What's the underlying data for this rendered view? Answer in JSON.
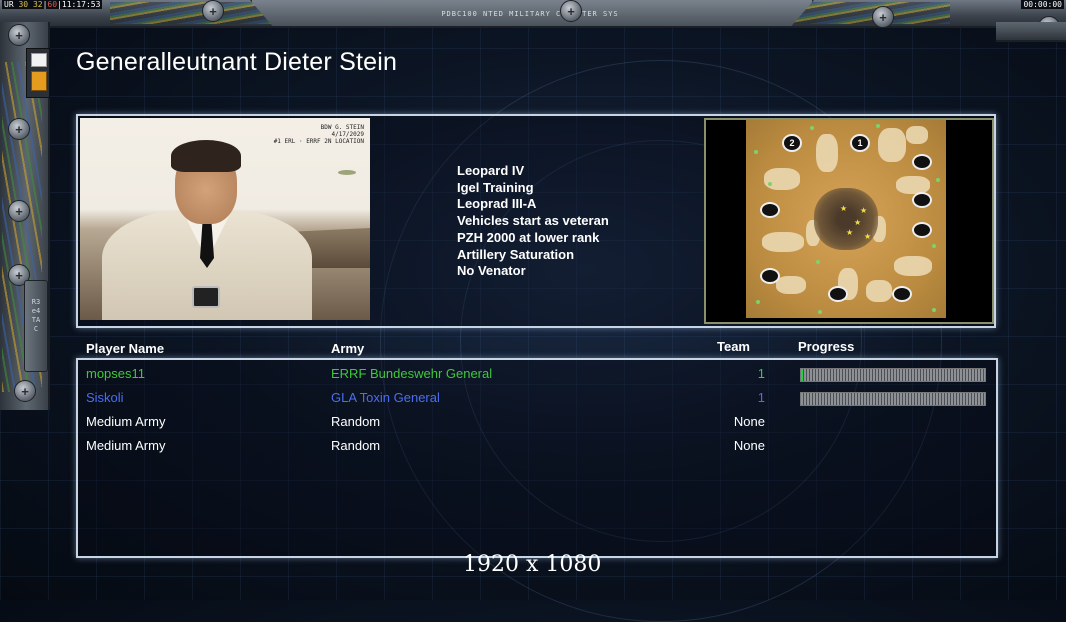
{
  "top_bar": {
    "timer_left_a": "UR",
    "timer_left_b": "30",
    "timer_left_c": "32",
    "timer_left_d": "60",
    "clock": "11:17:53",
    "system_title": "PDBC100 NTED MILITARY COMPUTER SYS",
    "timer_right": "00:00:00"
  },
  "left_panel": {
    "bracket_text": "R3e4TAC"
  },
  "general": {
    "title": "Generalleutnant Dieter Stein",
    "portrait_caption_1": "BDW G. STEIN",
    "portrait_caption_2": "4/17/2029",
    "portrait_caption_3": "#1 ERL · ERRF 2N LOCATION"
  },
  "rules": [
    "Leopard IV",
    "Igel Training",
    "Leoprad III-A",
    "Vehicles start as veteran",
    "PZH 2000 at lower rank",
    "Artillery Saturation",
    "No Venator"
  ],
  "minimap": {
    "start_1": "1",
    "start_2": "2"
  },
  "table": {
    "headers": {
      "player": "Player Name",
      "army": "Army",
      "team": "Team",
      "progress": "Progress"
    },
    "rows": [
      {
        "name": "mopses11",
        "army": "ERRF Bundeswehr General",
        "team": "1",
        "progress": 0.01,
        "color": "#41c83a"
      },
      {
        "name": "Siskoli",
        "army": "GLA Toxin General",
        "team": "1",
        "progress": 0.0,
        "color": "#4d6df0"
      },
      {
        "name": "Medium Army",
        "army": "Random",
        "team": "None",
        "progress": null,
        "color": "#ffffff"
      },
      {
        "name": "Medium Army",
        "army": "Random",
        "team": "None",
        "progress": null,
        "color": "#ffffff"
      }
    ]
  },
  "resolution_label": "1920 x 1080",
  "colors": {
    "panel_border": "#c6d4e4",
    "progress_fill": "#1ed24a"
  }
}
